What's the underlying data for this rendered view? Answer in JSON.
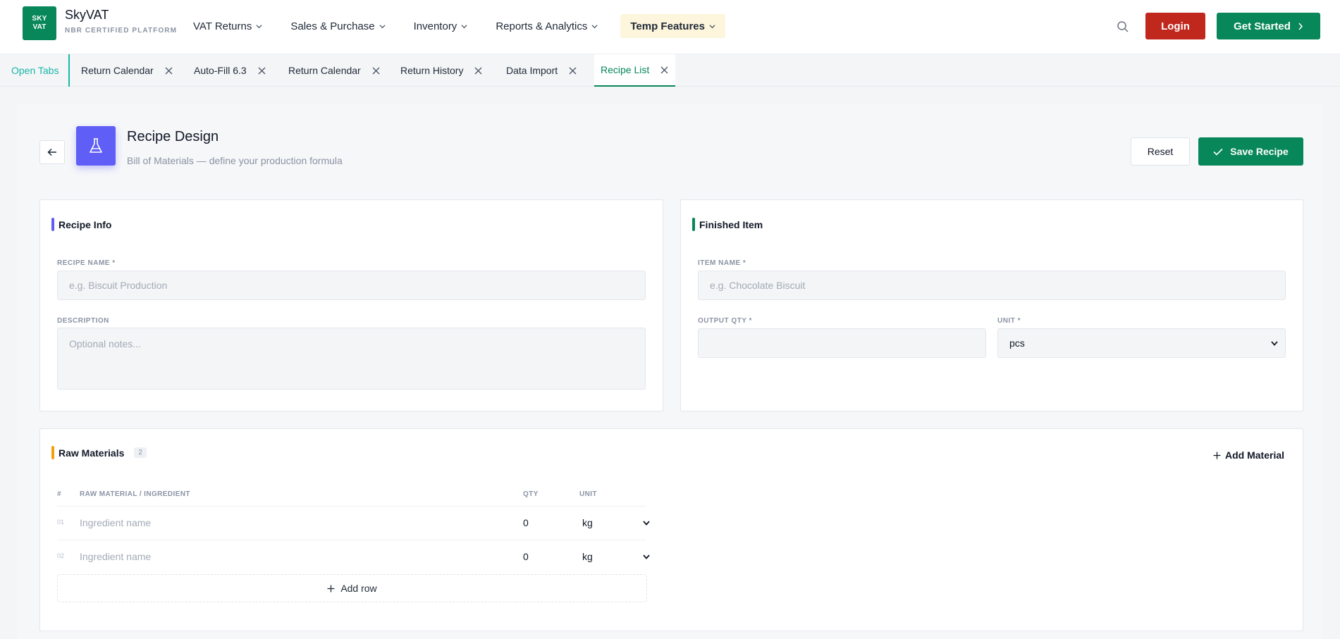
{
  "brand": {
    "logo_line1": "SKY",
    "logo_line2": "VAT",
    "name": "SkyVAT",
    "subtitle": "NBR CERTIFIED PLATFORM"
  },
  "nav": {
    "items": [
      {
        "label": "VAT Returns"
      },
      {
        "label": "Sales & Purchase"
      },
      {
        "label": "Inventory"
      },
      {
        "label": "Reports & Analytics"
      },
      {
        "label": "Temp Features"
      }
    ],
    "login_label": "Login",
    "get_started_label": "Get Started"
  },
  "tabs": {
    "open_tabs_label": "Open Tabs",
    "items": [
      {
        "label": "Return Calendar"
      },
      {
        "label": "Auto-Fill 6.3"
      },
      {
        "label": "Return Calendar"
      },
      {
        "label": "Return History"
      },
      {
        "label": "Data Import"
      },
      {
        "label": "Recipe List",
        "active": true
      }
    ]
  },
  "page": {
    "title": "Recipe Design",
    "subtitle": "Bill of Materials — define your production formula",
    "reset_label": "Reset",
    "save_label": "Save Recipe"
  },
  "recipe_info": {
    "title": "Recipe Info",
    "name_label": "RECIPE NAME *",
    "name_placeholder": "e.g. Biscuit Production",
    "name_value": "",
    "description_label": "DESCRIPTION",
    "description_placeholder": "Optional notes...",
    "description_value": ""
  },
  "finished_item": {
    "title": "Finished Item",
    "item_name_label": "ITEM NAME *",
    "item_name_placeholder": "e.g. Chocolate Biscuit",
    "item_name_value": "",
    "output_qty_label": "OUTPUT QTY *",
    "output_qty_value": "",
    "unit_label": "UNIT *",
    "unit_value": "pcs"
  },
  "raw_materials": {
    "title": "Raw Materials",
    "count": "2",
    "add_material_label": "Add Material",
    "columns": {
      "num": "#",
      "name": "RAW MATERIAL / INGREDIENT",
      "qty": "QTY",
      "unit": "UNIT"
    },
    "rows": [
      {
        "num": "01",
        "name_placeholder": "Ingredient name",
        "qty": "0",
        "unit": "kg"
      },
      {
        "num": "02",
        "name_placeholder": "Ingredient name",
        "qty": "0",
        "unit": "kg"
      }
    ],
    "add_row_label": "Add row"
  },
  "colors": {
    "brand_green": "#07875a",
    "login_red": "#c0271d",
    "accent_indigo": "#5f5ef6",
    "accent_teal": "#1ab5a8",
    "accent_orange": "#f59e0b",
    "temp_features_bg": "#fdf5dc"
  },
  "icons": [
    "chevron-down-icon",
    "search-icon",
    "chevron-right-icon",
    "close-icon",
    "arrow-left-icon",
    "flask-icon",
    "check-icon",
    "plus-icon"
  ]
}
